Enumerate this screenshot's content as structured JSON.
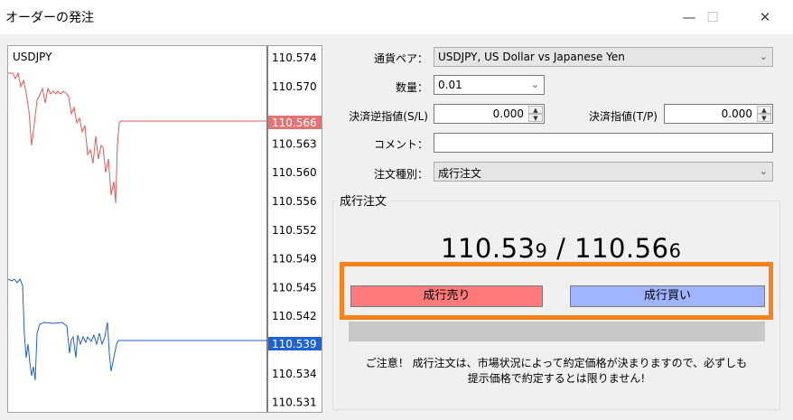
{
  "window": {
    "title": "オーダーの発注",
    "minimize": "—",
    "maximize": "☐",
    "close": "✕"
  },
  "chart": {
    "symbol": "USDJPY",
    "price_levels": [
      "110.574",
      "110.570",
      "110.566",
      "110.563",
      "110.560",
      "110.556",
      "110.552",
      "110.549",
      "110.545",
      "110.542",
      "110.539",
      "110.534",
      "110.531"
    ],
    "ask_marker": "110.566",
    "bid_marker": "110.539",
    "colors": {
      "ask": "#e05a5a",
      "bid": "#1f5fd0",
      "ask_marker_bg": "#e57373",
      "bid_marker_bg": "#1e63d6"
    }
  },
  "form": {
    "symbol_label": "通貨ペア：",
    "symbol_value": "USDJPY, US Dollar vs Japanese Yen",
    "volume_label": "数量：",
    "volume_value": "0.01",
    "sl_label": "決済逆指値(S/L)",
    "sl_value": "0.000",
    "tp_label": "決済指値(T/P)",
    "tp_value": "0.000",
    "comment_label": "コメント：",
    "comment_value": "",
    "type_label": "注文種別：",
    "type_value": "成行注文"
  },
  "market": {
    "group_title": "成行注文",
    "bid_main": "110.53",
    "bid_small": "9",
    "separator": " / ",
    "ask_main": "110.56",
    "ask_small": "6",
    "sell_label": "成行売り",
    "buy_label": "成行買い",
    "note_line1": "ご注意！ 成行注文は、市場状況によって約定価格が決まりますので、必ずしも",
    "note_line2": "提示価格で約定するとは限りません!",
    "highlight_color": "#f7821b"
  }
}
